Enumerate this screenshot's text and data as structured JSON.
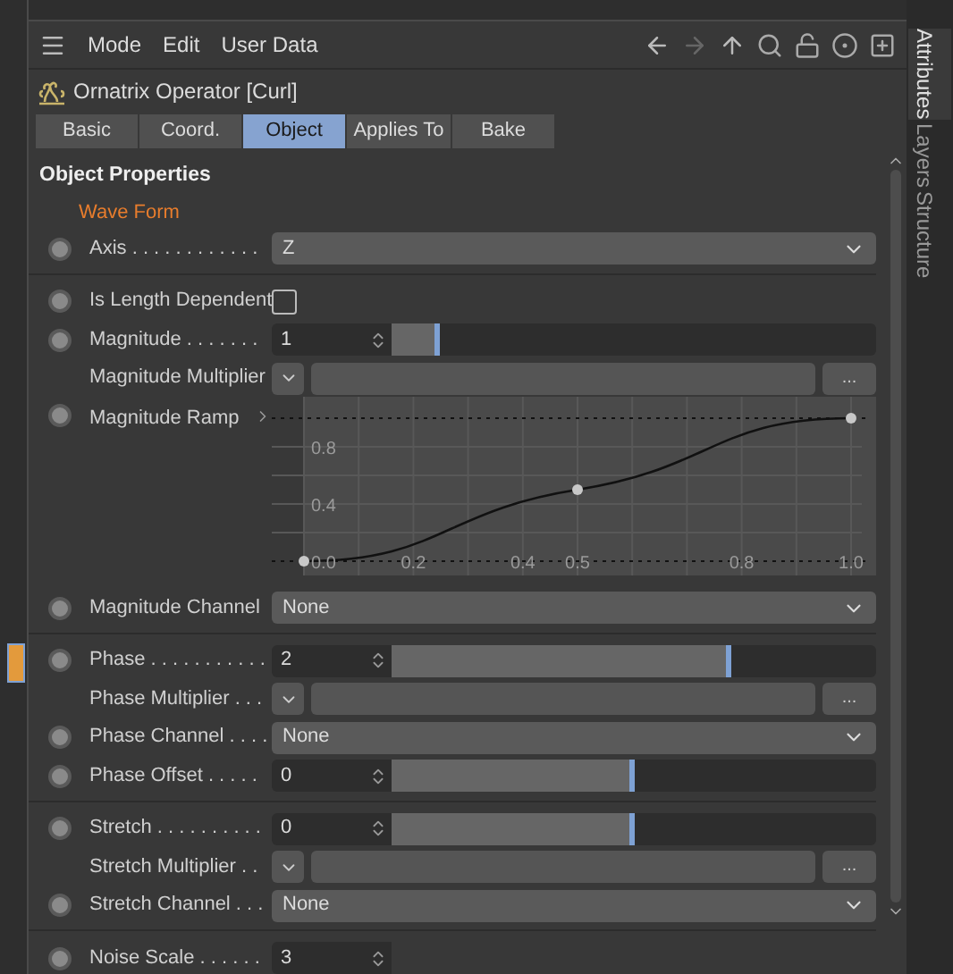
{
  "menu": [
    "Mode",
    "Edit",
    "User Data"
  ],
  "object_title": "Ornatrix Operator [Curl]",
  "tabs": [
    {
      "label": "Basic",
      "selected": false
    },
    {
      "label": "Coord.",
      "selected": false
    },
    {
      "label": "Object",
      "selected": true
    },
    {
      "label": "Applies To",
      "selected": false
    },
    {
      "label": "Bake",
      "selected": false
    }
  ],
  "section_title": "Object Properties",
  "group_title": "Wave Form",
  "rows": [
    {
      "kind": "dropdown",
      "label": "Axis . . . . . . . . . . . .",
      "keyframe": true,
      "value": "Z",
      "divider_after": true
    },
    {
      "kind": "checkbox",
      "label": "Is Length Dependent",
      "keyframe": true,
      "checked": false
    },
    {
      "kind": "slider",
      "label": "Magnitude . . . . . . .",
      "keyframe": true,
      "value": "1",
      "level": 0.1
    },
    {
      "kind": "multiplier",
      "label": "Magnitude Multiplier",
      "keyframe": false,
      "button": "..."
    },
    {
      "kind": "ramp",
      "label": "Magnitude Ramp",
      "keyframe": true,
      "chart_data": {
        "type": "line",
        "x": [
          0,
          0.5,
          1
        ],
        "series": [
          {
            "color": "#111111",
            "marker": "circle",
            "values": [
              0,
              0.5,
              1
            ]
          }
        ],
        "grid": true,
        "xlim": [
          0,
          1
        ],
        "ylim": [
          0,
          1
        ],
        "xticks": [
          {
            "value": 0,
            "label": "0.0"
          },
          {
            "value": 0.2,
            "label": "0.2"
          },
          {
            "value": 0.4,
            "label": "0.4"
          },
          {
            "value": 0.5,
            "label": "0.5"
          },
          {
            "value": 0.8,
            "label": "0.8"
          },
          {
            "value": 1,
            "label": "1.0"
          }
        ],
        "yticks": [
          0.4,
          0.8
        ]
      }
    },
    {
      "kind": "dropdown",
      "label": "Magnitude Channel",
      "keyframe": true,
      "value": "None",
      "divider_after": true
    },
    {
      "kind": "slider",
      "label": "Phase . . . . . . . . . . .",
      "keyframe": true,
      "value": "2",
      "level": 0.7
    },
    {
      "kind": "multiplier",
      "label": "Phase Multiplier . . .",
      "keyframe": false,
      "button": "..."
    },
    {
      "kind": "dropdown",
      "label": "Phase Channel . . . .",
      "keyframe": true,
      "value": "None"
    },
    {
      "kind": "slider",
      "label": "Phase Offset . . . . .",
      "keyframe": true,
      "value": "0",
      "level": 0.5,
      "divider_after": true
    },
    {
      "kind": "slider",
      "label": "Stretch . . . . . . . . . .",
      "keyframe": true,
      "value": "0",
      "level": 0.5
    },
    {
      "kind": "multiplier",
      "label": "Stretch Multiplier . .",
      "keyframe": false,
      "button": "..."
    },
    {
      "kind": "dropdown",
      "label": "Stretch Channel . . .",
      "keyframe": true,
      "value": "None",
      "divider_after": true
    },
    {
      "kind": "number",
      "label": "Noise Scale . . . . . .",
      "keyframe": true,
      "value": "3"
    }
  ],
  "side_tabs": [
    {
      "label": "Attributes",
      "selected": true
    },
    {
      "label": "Layers",
      "selected": false
    },
    {
      "label": "Structure",
      "selected": false
    }
  ]
}
